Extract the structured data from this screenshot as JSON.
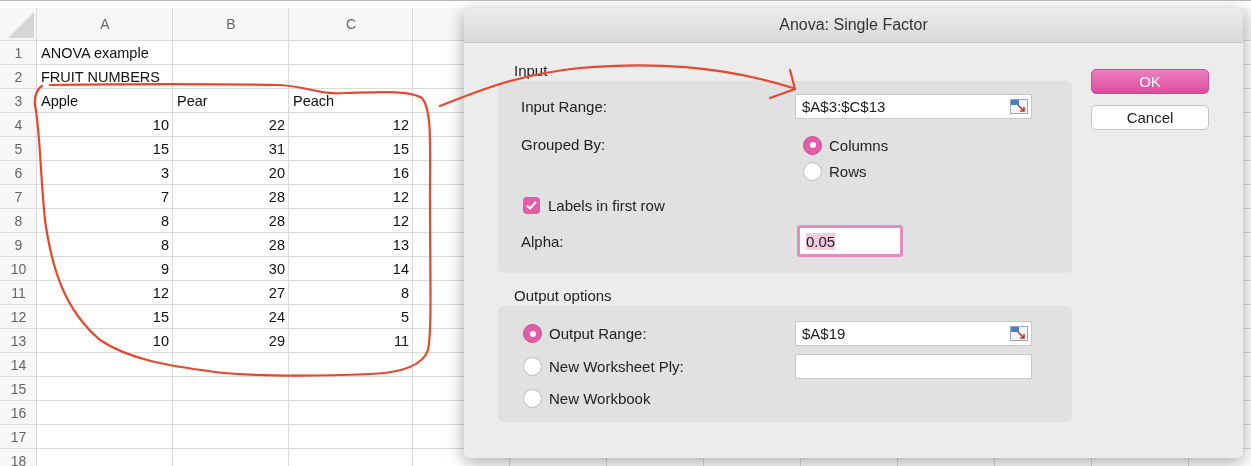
{
  "spreadsheet": {
    "columns": [
      "A",
      "B",
      "C"
    ],
    "rows": [
      {
        "number": "1",
        "cells": [
          {
            "kind": "text",
            "text": "ANOVA example"
          }
        ]
      },
      {
        "number": "2",
        "cells": [
          {
            "kind": "text",
            "text": "FRUIT NUMBERS"
          }
        ]
      },
      {
        "number": "3",
        "cells": [
          {
            "kind": "text",
            "text": "Apple"
          },
          {
            "kind": "text",
            "text": "Pear"
          },
          {
            "kind": "text",
            "text": "Peach"
          }
        ]
      },
      {
        "number": "4",
        "cells": [
          {
            "kind": "number",
            "text": "10"
          },
          {
            "kind": "number",
            "text": "22"
          },
          {
            "kind": "number",
            "text": "12"
          }
        ]
      },
      {
        "number": "5",
        "cells": [
          {
            "kind": "number",
            "text": "15"
          },
          {
            "kind": "number",
            "text": "31"
          },
          {
            "kind": "number",
            "text": "15"
          }
        ]
      },
      {
        "number": "6",
        "cells": [
          {
            "kind": "number",
            "text": "3"
          },
          {
            "kind": "number",
            "text": "20"
          },
          {
            "kind": "number",
            "text": "16"
          }
        ]
      },
      {
        "number": "7",
        "cells": [
          {
            "kind": "number",
            "text": "7"
          },
          {
            "kind": "number",
            "text": "28"
          },
          {
            "kind": "number",
            "text": "12"
          }
        ]
      },
      {
        "number": "8",
        "cells": [
          {
            "kind": "number",
            "text": "8"
          },
          {
            "kind": "number",
            "text": "28"
          },
          {
            "kind": "number",
            "text": "12"
          }
        ]
      },
      {
        "number": "9",
        "cells": [
          {
            "kind": "number",
            "text": "8"
          },
          {
            "kind": "number",
            "text": "28"
          },
          {
            "kind": "number",
            "text": "13"
          }
        ]
      },
      {
        "number": "10",
        "cells": [
          {
            "kind": "number",
            "text": "9"
          },
          {
            "kind": "number",
            "text": "30"
          },
          {
            "kind": "number",
            "text": "14"
          }
        ]
      },
      {
        "number": "11",
        "cells": [
          {
            "kind": "number",
            "text": "12"
          },
          {
            "kind": "number",
            "text": "27"
          },
          {
            "kind": "number",
            "text": "8"
          }
        ]
      },
      {
        "number": "12",
        "cells": [
          {
            "kind": "number",
            "text": "15"
          },
          {
            "kind": "number",
            "text": "24"
          },
          {
            "kind": "number",
            "text": "5"
          }
        ]
      },
      {
        "number": "13",
        "cells": [
          {
            "kind": "number",
            "text": "10"
          },
          {
            "kind": "number",
            "text": "29"
          },
          {
            "kind": "number",
            "text": "11"
          }
        ]
      },
      {
        "number": "14"
      },
      {
        "number": "15"
      },
      {
        "number": "16"
      },
      {
        "number": "17"
      },
      {
        "number": "18"
      }
    ]
  },
  "dialog": {
    "title": "Anova: Single Factor",
    "input": {
      "heading": "Input",
      "range_label": "Input Range:",
      "range_value": "$A$3:$C$13",
      "grouped_by_label": "Grouped By:",
      "grouped_by_options": [
        {
          "label": "Columns",
          "selected": true
        },
        {
          "label": "Rows",
          "selected": false
        }
      ],
      "labels_checkbox": {
        "label": "Labels in first row",
        "checked": true
      },
      "alpha_label": "Alpha:",
      "alpha_value": "0.05",
      "alpha_focused": true
    },
    "output": {
      "heading": "Output options",
      "options": [
        {
          "kind": "range",
          "label": "Output Range:",
          "value": "$A$19",
          "selected": true
        },
        {
          "kind": "text_field",
          "label": "New Worksheet Ply:",
          "selected": false
        },
        {
          "kind": "plain",
          "label": "New Workbook",
          "selected": false
        }
      ]
    },
    "buttons": [
      {
        "label": "OK",
        "default": true
      },
      {
        "label": "Cancel",
        "default": false
      }
    ]
  }
}
